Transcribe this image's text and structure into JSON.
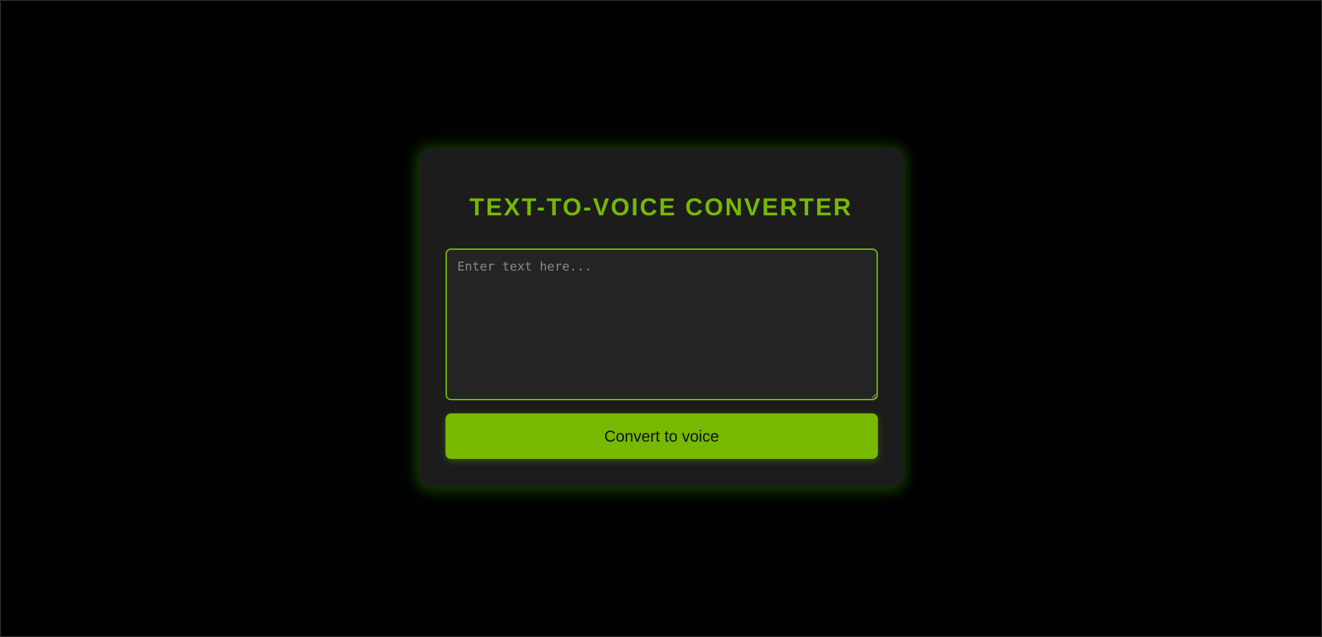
{
  "app": {
    "title": "TEXT-TO-VOICE CONVERTER"
  },
  "input": {
    "value": "",
    "placeholder": "Enter text here..."
  },
  "actions": {
    "convert_label": "Convert to voice"
  },
  "colors": {
    "background": "#000000",
    "card": "#1c1c1c",
    "accent": "#76b900",
    "textarea_bg": "#242424",
    "placeholder": "#8a8a8a"
  }
}
